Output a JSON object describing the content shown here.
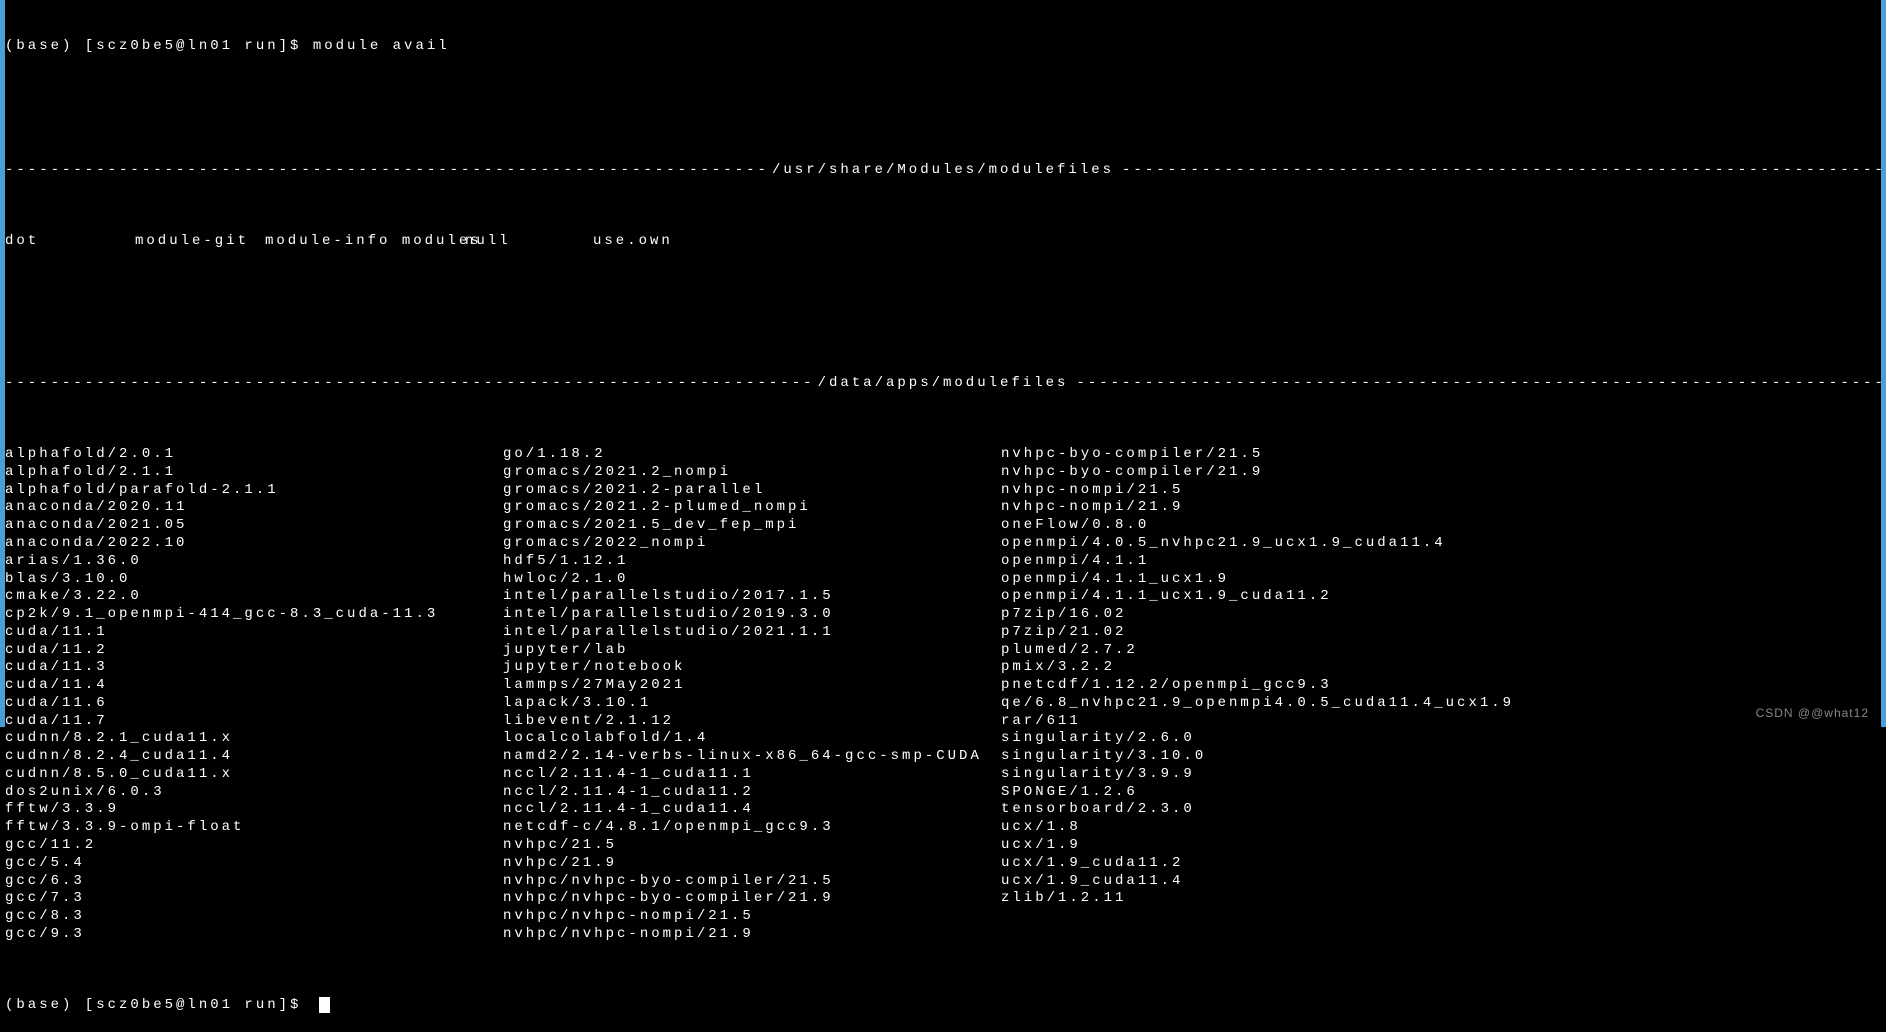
{
  "prompt1": "(base) [scz0be5@ln01 run]$ ",
  "command": "module avail",
  "section1": {
    "title": "/usr/share/Modules/modulefiles",
    "row": {
      "c1": "dot",
      "c2": "module-git",
      "c3": "module-info modules",
      "c4": "null",
      "c5": "use.own"
    }
  },
  "section2": {
    "title": "/data/apps/modulefiles",
    "col1": [
      "alphafold/2.0.1",
      "alphafold/2.1.1",
      "alphafold/parafold-2.1.1",
      "anaconda/2020.11",
      "anaconda/2021.05",
      "anaconda/2022.10",
      "arias/1.36.0",
      "blas/3.10.0",
      "cmake/3.22.0",
      "cp2k/9.1_openmpi-414_gcc-8.3_cuda-11.3",
      "cuda/11.1",
      "cuda/11.2",
      "cuda/11.3",
      "cuda/11.4",
      "cuda/11.6",
      "cuda/11.7",
      "cudnn/8.2.1_cuda11.x",
      "cudnn/8.2.4_cuda11.4",
      "cudnn/8.5.0_cuda11.x",
      "dos2unix/6.0.3",
      "fftw/3.3.9",
      "fftw/3.3.9-ompi-float",
      "gcc/11.2",
      "gcc/5.4",
      "gcc/6.3",
      "gcc/7.3",
      "gcc/8.3",
      "gcc/9.3"
    ],
    "col2": [
      "go/1.18.2",
      "gromacs/2021.2_nompi",
      "gromacs/2021.2-parallel",
      "gromacs/2021.2-plumed_nompi",
      "gromacs/2021.5_dev_fep_mpi",
      "gromacs/2022_nompi",
      "hdf5/1.12.1",
      "hwloc/2.1.0",
      "intel/parallelstudio/2017.1.5",
      "intel/parallelstudio/2019.3.0",
      "intel/parallelstudio/2021.1.1",
      "jupyter/lab",
      "jupyter/notebook",
      "lammps/27May2021",
      "lapack/3.10.1",
      "libevent/2.1.12",
      "localcolabfold/1.4",
      "namd2/2.14-verbs-linux-x86_64-gcc-smp-CUDA",
      "nccl/2.11.4-1_cuda11.1",
      "nccl/2.11.4-1_cuda11.2",
      "nccl/2.11.4-1_cuda11.4",
      "netcdf-c/4.8.1/openmpi_gcc9.3",
      "nvhpc/21.5",
      "nvhpc/21.9",
      "nvhpc/nvhpc-byo-compiler/21.5",
      "nvhpc/nvhpc-byo-compiler/21.9",
      "nvhpc/nvhpc-nompi/21.5",
      "nvhpc/nvhpc-nompi/21.9"
    ],
    "col3": [
      "nvhpc-byo-compiler/21.5",
      "nvhpc-byo-compiler/21.9",
      "nvhpc-nompi/21.5",
      "nvhpc-nompi/21.9",
      "oneFlow/0.8.0",
      "openmpi/4.0.5_nvhpc21.9_ucx1.9_cuda11.4",
      "openmpi/4.1.1",
      "openmpi/4.1.1_ucx1.9",
      "openmpi/4.1.1_ucx1.9_cuda11.2",
      "p7zip/16.02",
      "p7zip/21.02",
      "plumed/2.7.2",
      "pmix/3.2.2",
      "pnetcdf/1.12.2/openmpi_gcc9.3",
      "qe/6.8_nvhpc21.9_openmpi4.0.5_cuda11.4_ucx1.9",
      "rar/611",
      "singularity/2.6.0",
      "singularity/3.10.0",
      "singularity/3.9.9",
      "SPONGE/1.2.6",
      "tensorboard/2.3.0",
      "ucx/1.8",
      "ucx/1.9",
      "ucx/1.9_cuda11.2",
      "ucx/1.9_cuda11.4",
      "zlib/1.2.11"
    ]
  },
  "prompt2": "(base) [scz0be5@ln01 run]$ ",
  "dashes": "----------------------------------------------------------------------------------------------------------------------------------------",
  "watermark": "CSDN @@what12"
}
